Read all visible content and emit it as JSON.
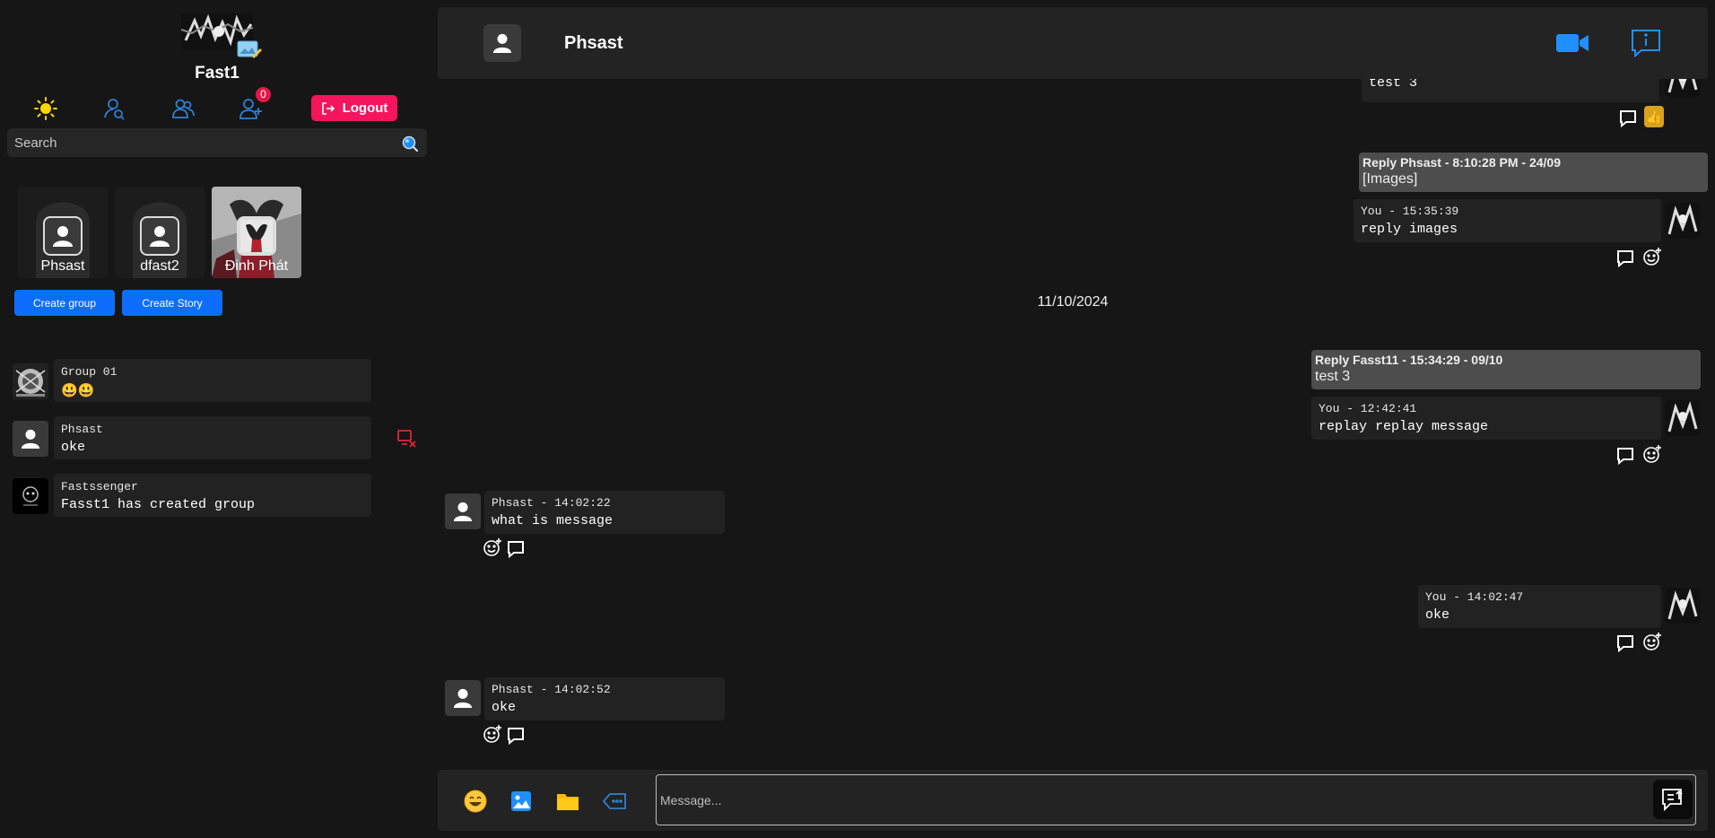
{
  "profile": {
    "name": "Fast1"
  },
  "topbar": {
    "friend_requests_count": "0",
    "logout_label": "Logout"
  },
  "search": {
    "placeholder": "Search"
  },
  "stories": [
    {
      "name": "Phsast"
    },
    {
      "name": "dfast2"
    },
    {
      "name": "Đinh Phát"
    }
  ],
  "actions": {
    "create_group": "Create group",
    "create_story": "Create Story"
  },
  "conversations": [
    {
      "name": "Group 01",
      "last_message": "😃😃"
    },
    {
      "name": "Phsast",
      "last_message": "oke"
    },
    {
      "name": "Fastssenger",
      "last_message": "Fasst1 has created group"
    }
  ],
  "chat": {
    "header_name": "Phsast",
    "date_separator": "11/10/2024",
    "messages": [
      {
        "text": "test 3",
        "reaction": "👍"
      },
      {
        "reply_head": "Reply Phsast - 8:10:28 PM - 24/09",
        "reply_text": "[Images]",
        "meta": "You - 15:35:39",
        "text": "reply images"
      },
      {
        "reply_head": "Reply Fasst11 - 15:34:29 - 09/10",
        "reply_text": "test 3",
        "meta": "You - 12:42:41",
        "text": "replay replay message"
      },
      {
        "meta": "Phsast - 14:02:22",
        "text": "what is message"
      },
      {
        "meta": "You - 14:02:47",
        "text": "oke"
      },
      {
        "meta": "Phsast - 14:02:52",
        "text": "oke"
      }
    ]
  },
  "composer": {
    "placeholder": "Message..."
  },
  "colors": {
    "accent_pink": "#f5145e",
    "primary_blue": "#0d6efd",
    "icon_blue": "#1e90ff",
    "sun_yellow": "#ffd600",
    "reaction_bg": "#d9a21c"
  }
}
